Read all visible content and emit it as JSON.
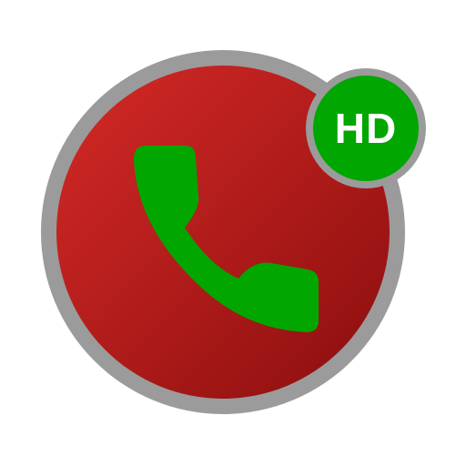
{
  "icon": {
    "name": "hd-call-recorder-app-icon",
    "badge_text": "HD",
    "glyph": "phone-handset-icon",
    "colors": {
      "outer_ring": "#9b9b9b",
      "disc_light": "#d52a27",
      "disc_dark": "#8a0e0e",
      "handset": "#01a601",
      "badge_fill": "#01a601",
      "badge_border": "#9b9b9b",
      "badge_text": "#ffffff"
    }
  }
}
